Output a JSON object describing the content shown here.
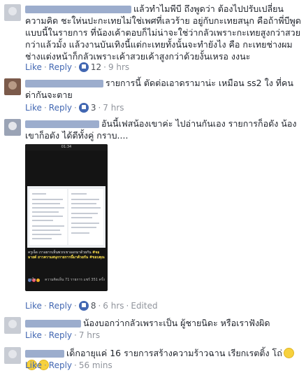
{
  "comments": [
    {
      "text": "แล้วทำไมพีบี ถึงพูดว่า ต้องไปปรับเปลี่ยนความคิด ชะให่นปะกะเทยไม่ใช่เพศที่เลวร้าย อยู่กับกะเทยสนุก คือถ้าพี่บีพูดแบบนี้ในรายการ ที่น้องเค้าตอบก็ไม่น่าจะใช่ว่ากลัวเพราะกะเทยสูงกว่าสวยกว่าแล้วมั้ง แล้วงานบันเทิงนี้แต่กะเทยทั้งนั้นจะทำยังไง คือ กะเทยช่างผมช่างแต่งหน้าก็กลัวเพราะเค้าสวยเค้าสูงกว่าด้วยงั้นเหรอ งงนะ",
      "like": "Like",
      "reply": "Reply",
      "reactions": "12",
      "time": "9 hrs"
    },
    {
      "text": "รายการนี้ ตัดต่อเอาดรามาน่ะ เหมือน ss2 ใง ที่คนด่ากันจะตาย",
      "like": "Like",
      "reply": "Reply",
      "reactions": "3",
      "time": "7 hrs"
    },
    {
      "text": "อันนี้เฟสน้องเขาค่ะ ไปอ่านกันเอง รายการก็อดัง น้องเขาก็อดัง ได้ดีทั้งคู่ กราบ....",
      "like": "Like",
      "reply": "Reply",
      "reactions": "8",
      "time": "6 hrs",
      "edited": "Edited"
    },
    {
      "text": "น้องบอกว่ากลัวเพราะเป็น ผู้ชายนิดะ หรือเราฟังผิด",
      "like": "Like",
      "reply": "Reply",
      "time": "7 hrs"
    },
    {
      "text": "เด็กอายุแค่ 16 รายการสร้างความร้าวฉาน เรียกเรตติ้ง โถ่",
      "like": "Like",
      "reply": "Reply",
      "time": "56 mins"
    }
  ],
  "screenshot": {
    "status_time": "01:34",
    "caption_prefix": "ครูเจ็ด เราอยากเห็นพวกเขาออกมาด้วยกัน",
    "caption_highlight": "#จอมายด์ ยาวความสนุกรายการนี้มาด้วยกัน #ขอบคุณ",
    "footer_left": "ถูกใจ",
    "footer_right": "ความคิดเห็น 71 รายการ แชร์ 351 ครั้ง"
  },
  "colors": {
    "link": "#4267b2",
    "meta": "#90949c",
    "text": "#1d2129",
    "reaction": "#4267b2"
  }
}
